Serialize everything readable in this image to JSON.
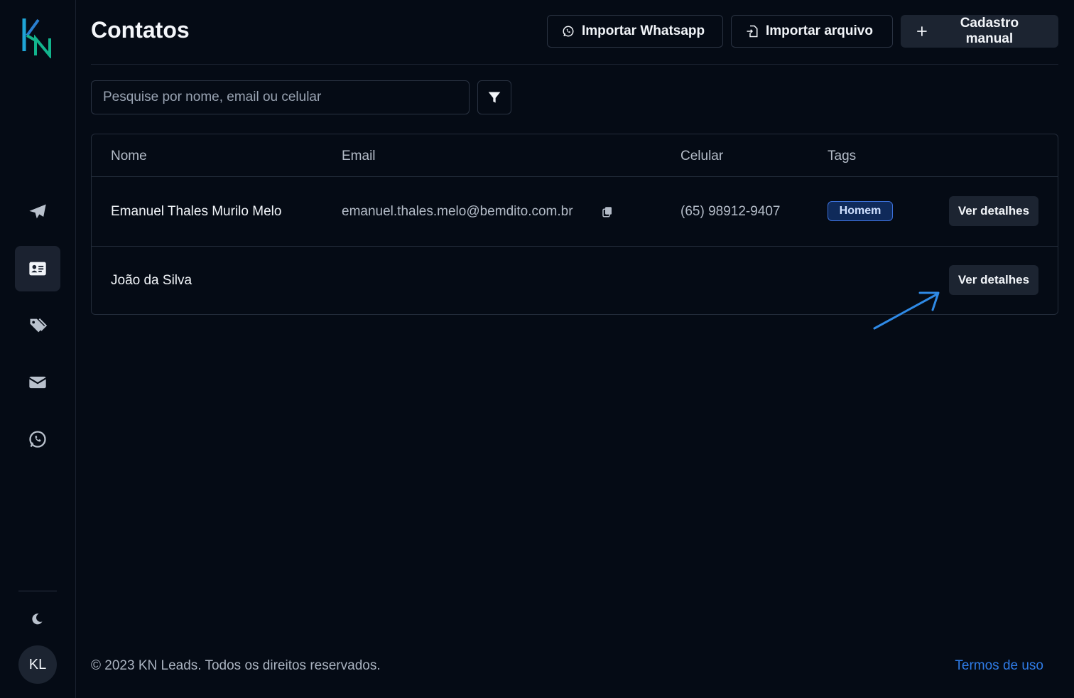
{
  "app": {
    "logo_text": "KN"
  },
  "sidebar": {
    "items": [
      {
        "icon": "paper-plane-icon",
        "active": false
      },
      {
        "icon": "contact-card-icon",
        "active": true
      },
      {
        "icon": "tags-icon",
        "active": false
      },
      {
        "icon": "envelope-icon",
        "active": false
      },
      {
        "icon": "whatsapp-icon",
        "active": false
      }
    ],
    "theme_icon": "moon-icon",
    "avatar_initials": "KL"
  },
  "header": {
    "title": "Contatos",
    "import_whatsapp_label": "Importar Whatsapp",
    "import_file_label": "Importar arquivo",
    "manual_register_label": "Cadastro manual"
  },
  "search": {
    "placeholder": "Pesquise por nome, email ou celular",
    "value": ""
  },
  "table": {
    "columns": [
      "Nome",
      "Email",
      "Celular",
      "Tags"
    ],
    "rows": [
      {
        "name": "Emanuel Thales Murilo Melo",
        "email": "emanuel.thales.melo@bemdito.com.br",
        "phone": "(65) 98912-9407",
        "tags": [
          "Homem"
        ],
        "action_label": "Ver detalhes"
      },
      {
        "name": "João da Silva",
        "email": "",
        "phone": "",
        "tags": [],
        "action_label": "Ver detalhes"
      }
    ]
  },
  "annotation": {
    "arrow_color": "#2f8ae6"
  },
  "footer": {
    "copyright": "© 2023 KN Leads. Todos os direitos reservados.",
    "terms_label": "Termos de uso"
  },
  "colors": {
    "background": "#050b15",
    "accent": "#2f7be6",
    "tag_border": "#3b6fd8"
  }
}
